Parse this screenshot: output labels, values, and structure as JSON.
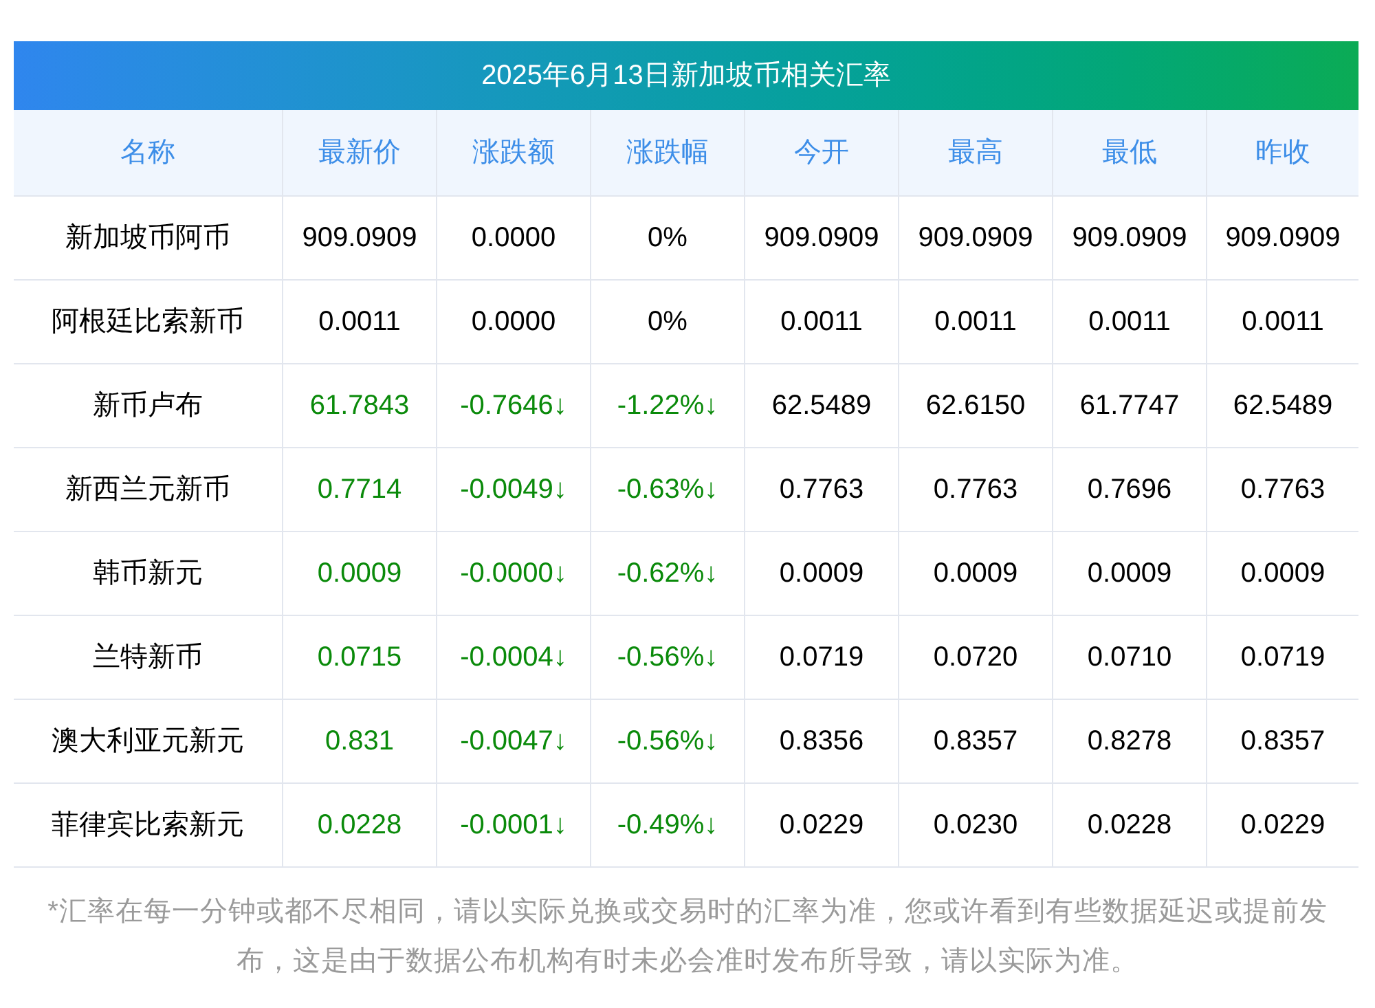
{
  "title": "2025年6月13日新加坡币相关汇率",
  "columns": [
    "名称",
    "最新价",
    "涨跌额",
    "涨跌幅",
    "今开",
    "最高",
    "最低",
    "昨收"
  ],
  "rows": [
    {
      "kind": "flat",
      "cells": [
        "新加坡币阿币",
        "909.0909",
        "0.0000",
        "0%",
        "909.0909",
        "909.0909",
        "909.0909",
        "909.0909"
      ]
    },
    {
      "kind": "flat",
      "cells": [
        "阿根廷比索新币",
        "0.0011",
        "0.0000",
        "0%",
        "0.0011",
        "0.0011",
        "0.0011",
        "0.0011"
      ]
    },
    {
      "kind": "down",
      "cells": [
        "新币卢布",
        "61.7843",
        "-0.7646↓",
        "-1.22%↓",
        "62.5489",
        "62.6150",
        "61.7747",
        "62.5489"
      ]
    },
    {
      "kind": "down",
      "cells": [
        "新西兰元新币",
        "0.7714",
        "-0.0049↓",
        "-0.63%↓",
        "0.7763",
        "0.7763",
        "0.7696",
        "0.7763"
      ]
    },
    {
      "kind": "down",
      "cells": [
        "韩币新元",
        "0.0009",
        "-0.0000↓",
        "-0.62%↓",
        "0.0009",
        "0.0009",
        "0.0009",
        "0.0009"
      ]
    },
    {
      "kind": "down",
      "cells": [
        "兰特新币",
        "0.0715",
        "-0.0004↓",
        "-0.56%↓",
        "0.0719",
        "0.0720",
        "0.0710",
        "0.0719"
      ]
    },
    {
      "kind": "down",
      "cells": [
        "澳大利亚元新元",
        "0.831",
        "-0.0047↓",
        "-0.56%↓",
        "0.8356",
        "0.8357",
        "0.8278",
        "0.8357"
      ]
    },
    {
      "kind": "down",
      "cells": [
        "菲律宾比索新元",
        "0.0228",
        "-0.0001↓",
        "-0.49%↓",
        "0.0229",
        "0.0230",
        "0.0228",
        "0.0229"
      ]
    }
  ],
  "footnote": "*汇率在每一分钟或都不尽相同，请以实际兑换或交易时的汇率为准，您或许看到有些数据延迟或提前发布，这是由于数据公布机构有时未必会准时发布所导致，请以实际为准。"
}
